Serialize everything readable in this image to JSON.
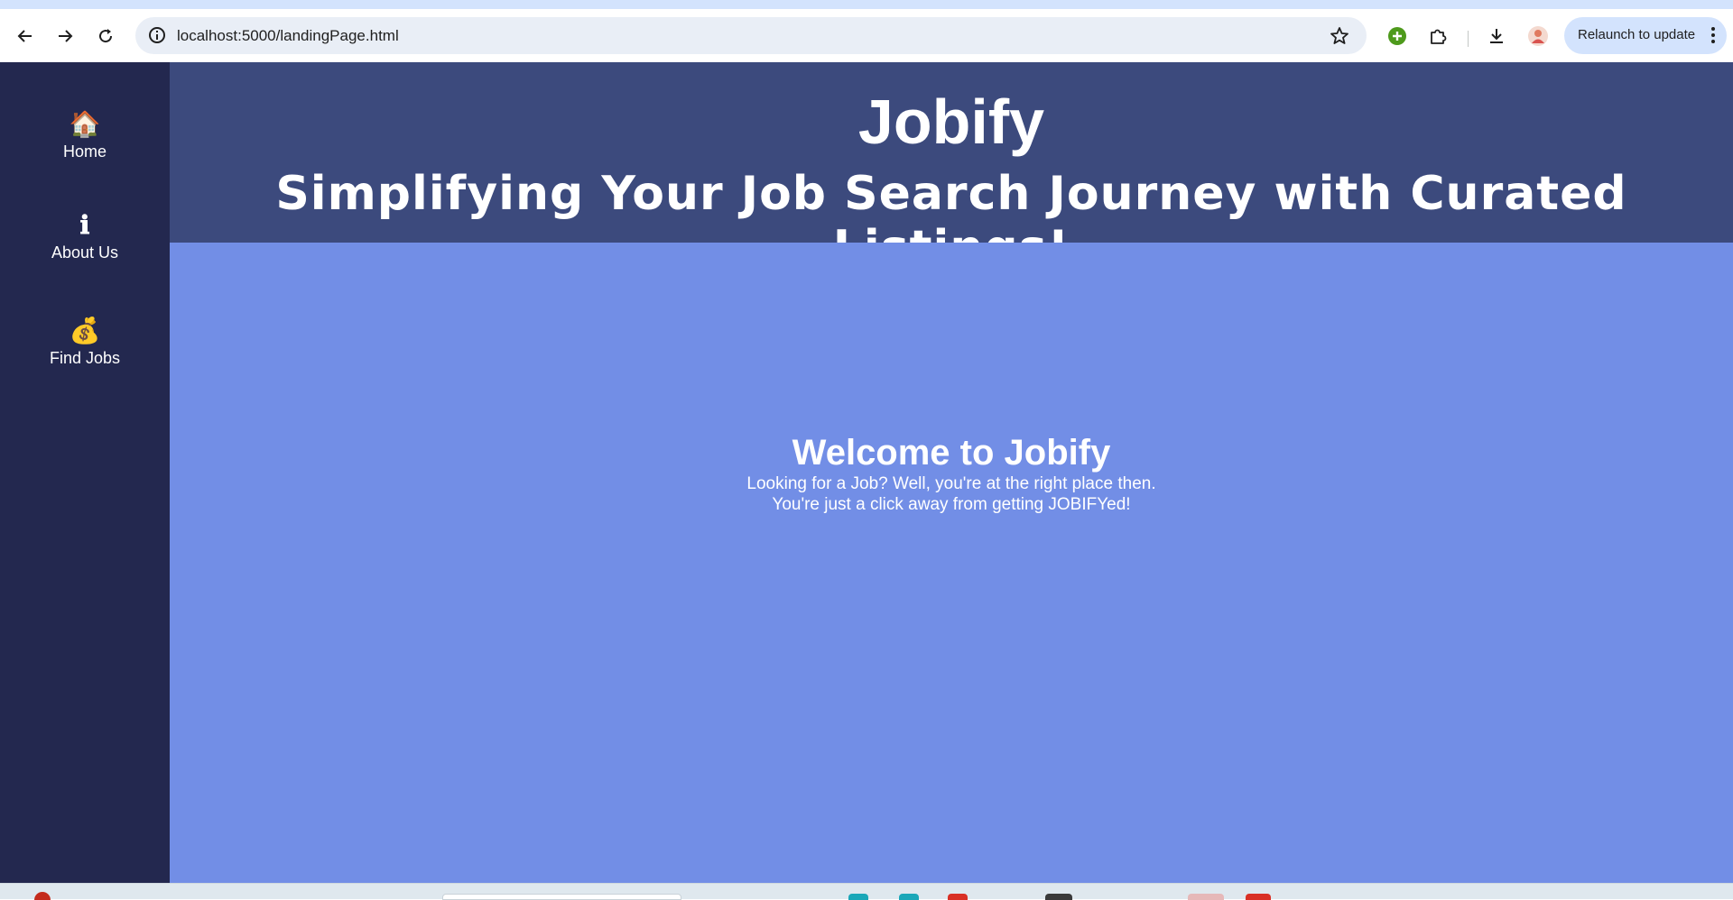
{
  "browser": {
    "url": "localhost:5000/landingPage.html",
    "relaunch_label": "Relaunch to update",
    "icons": [
      "back-arrow-icon",
      "forward-arrow-icon",
      "reload-icon",
      "site-info-icon",
      "bookmark-star-icon",
      "extension-add-icon",
      "extensions-puzzle-icon",
      "download-icon",
      "profile-avatar-icon",
      "menu-dots-icon"
    ]
  },
  "sidebar": {
    "items": [
      {
        "icon": "🏠",
        "icon_name": "home-icon",
        "label": "Home"
      },
      {
        "icon": "ℹ",
        "icon_name": "info-icon",
        "label": "About Us"
      },
      {
        "icon": "💰",
        "icon_name": "money-bag-icon",
        "label": "Find Jobs"
      }
    ]
  },
  "header": {
    "brand": "Jobify",
    "tagline": "Simplifying Your Job Search Journey with Curated Listings!"
  },
  "main": {
    "welcome": "Welcome to Jobify",
    "line1": "Looking for a Job? Well, you're at the right place then.",
    "line2": "You're just a click away from getting JOBIFYed!"
  },
  "colors": {
    "sidebar_bg": "#23284f",
    "header_bg": "#3c4a7d",
    "main_bg": "#728ee6",
    "text": "#ffffff"
  }
}
